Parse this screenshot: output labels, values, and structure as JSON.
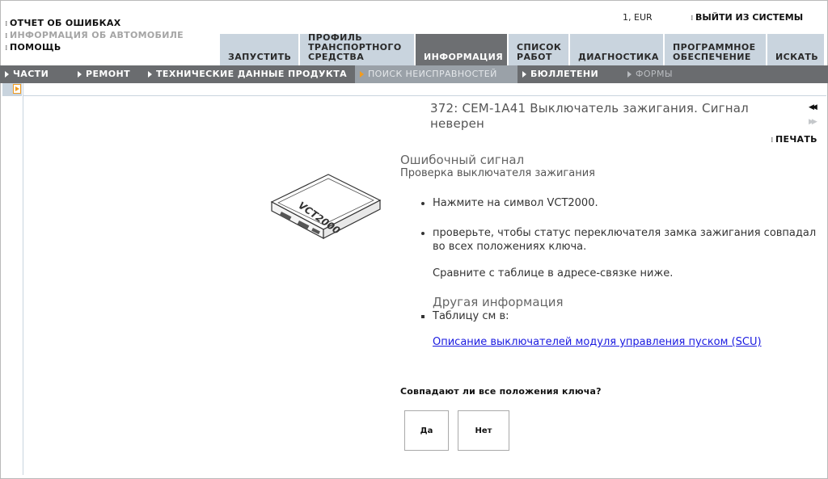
{
  "top_links": {
    "error_report": "ОТЧЕТ ОБ ОШИБКАХ",
    "vehicle_info": "ИНФОРМАЦИЯ ОБ АВТОМОБИЛЕ",
    "help": "ПОМОЩЬ"
  },
  "account": {
    "status": "1, EUR",
    "logout": "ВЫЙТИ ИЗ СИСТЕМЫ"
  },
  "tabs": [
    {
      "label": "ЗАПУСТИТЬ"
    },
    {
      "label": "ПРОФИЛЬ ТРАНСПОРТНОГО СРЕДСТВА"
    },
    {
      "label": "ИНФОРМАЦИЯ"
    },
    {
      "label": "СПИСОК РАБОТ"
    },
    {
      "label": "ДИАГНОСТИКА"
    },
    {
      "label": "ПРОГРАММНОЕ ОБЕСПЕЧЕНИЕ"
    },
    {
      "label": "ИСКАТЬ"
    }
  ],
  "subnav": [
    {
      "label": "ЧАСТИ"
    },
    {
      "label": "РЕМОНТ"
    },
    {
      "label": "ТЕХНИЧЕСКИЕ ДАННЫЕ ПРОДУКТА"
    },
    {
      "label": "ПОИСК НЕИСПРАВНОСТЕЙ"
    },
    {
      "label": "БЮЛЛЕТЕНИ"
    },
    {
      "label": "ФОРМЫ"
    }
  ],
  "page": {
    "title": "372: CEM-1A41 Выключатель зажигания. Сигнал неверен",
    "print": "ПЕЧАТЬ",
    "section_title": "Ошибочный сигнал",
    "section_subtitle": "Проверка выключателя зажигания",
    "device_label": "VCT2000",
    "bullets": [
      "Нажмите на символ VCT2000.",
      "проверьте, чтобы статус переключателя замка зажигания совпадал во всех положениях ключа."
    ],
    "compare_text": "Сравните с таблице в адресе-связке ниже.",
    "other_info_heading": "Другая информация",
    "table_ref": "Таблицу см в:",
    "link_text": "Описание выключателей модуля управления пуском (SCU)",
    "question": "Совпадают ли все положения ключа?",
    "yes": "Да",
    "no": "Нет"
  },
  "colors": {
    "tab_bg": "#c9d4de",
    "tab_active": "#6d6f72",
    "subnav_bg": "#6a6c6f",
    "accent": "#f29b1e",
    "link": "#1a1ae0"
  }
}
